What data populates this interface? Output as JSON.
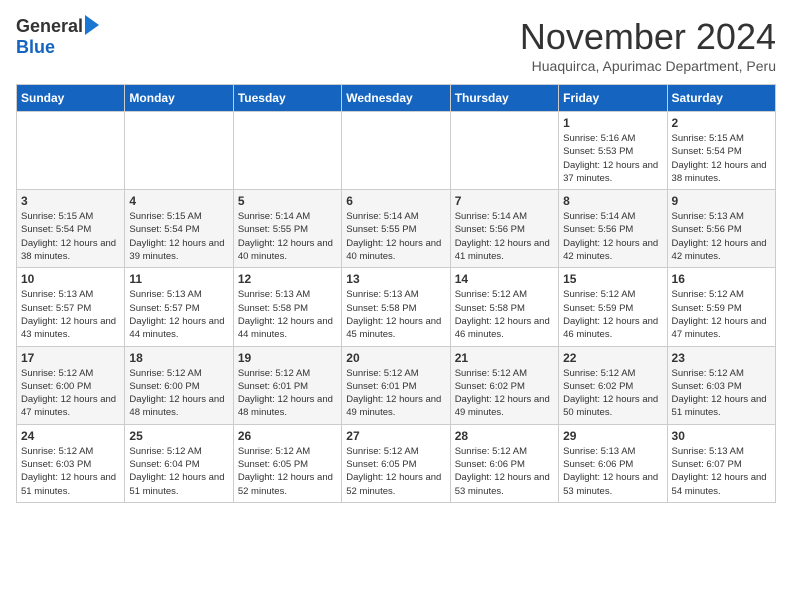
{
  "header": {
    "logo_general": "General",
    "logo_blue": "Blue",
    "month_title": "November 2024",
    "subtitle": "Huaquirca, Apurimac Department, Peru"
  },
  "weekdays": [
    "Sunday",
    "Monday",
    "Tuesday",
    "Wednesday",
    "Thursday",
    "Friday",
    "Saturday"
  ],
  "weeks": [
    [
      {
        "day": "",
        "info": ""
      },
      {
        "day": "",
        "info": ""
      },
      {
        "day": "",
        "info": ""
      },
      {
        "day": "",
        "info": ""
      },
      {
        "day": "",
        "info": ""
      },
      {
        "day": "1",
        "info": "Sunrise: 5:16 AM\nSunset: 5:53 PM\nDaylight: 12 hours\nand 37 minutes."
      },
      {
        "day": "2",
        "info": "Sunrise: 5:15 AM\nSunset: 5:54 PM\nDaylight: 12 hours\nand 38 minutes."
      }
    ],
    [
      {
        "day": "3",
        "info": "Sunrise: 5:15 AM\nSunset: 5:54 PM\nDaylight: 12 hours\nand 38 minutes."
      },
      {
        "day": "4",
        "info": "Sunrise: 5:15 AM\nSunset: 5:54 PM\nDaylight: 12 hours\nand 39 minutes."
      },
      {
        "day": "5",
        "info": "Sunrise: 5:14 AM\nSunset: 5:55 PM\nDaylight: 12 hours\nand 40 minutes."
      },
      {
        "day": "6",
        "info": "Sunrise: 5:14 AM\nSunset: 5:55 PM\nDaylight: 12 hours\nand 40 minutes."
      },
      {
        "day": "7",
        "info": "Sunrise: 5:14 AM\nSunset: 5:56 PM\nDaylight: 12 hours\nand 41 minutes."
      },
      {
        "day": "8",
        "info": "Sunrise: 5:14 AM\nSunset: 5:56 PM\nDaylight: 12 hours\nand 42 minutes."
      },
      {
        "day": "9",
        "info": "Sunrise: 5:13 AM\nSunset: 5:56 PM\nDaylight: 12 hours\nand 42 minutes."
      }
    ],
    [
      {
        "day": "10",
        "info": "Sunrise: 5:13 AM\nSunset: 5:57 PM\nDaylight: 12 hours\nand 43 minutes."
      },
      {
        "day": "11",
        "info": "Sunrise: 5:13 AM\nSunset: 5:57 PM\nDaylight: 12 hours\nand 44 minutes."
      },
      {
        "day": "12",
        "info": "Sunrise: 5:13 AM\nSunset: 5:58 PM\nDaylight: 12 hours\nand 44 minutes."
      },
      {
        "day": "13",
        "info": "Sunrise: 5:13 AM\nSunset: 5:58 PM\nDaylight: 12 hours\nand 45 minutes."
      },
      {
        "day": "14",
        "info": "Sunrise: 5:12 AM\nSunset: 5:58 PM\nDaylight: 12 hours\nand 46 minutes."
      },
      {
        "day": "15",
        "info": "Sunrise: 5:12 AM\nSunset: 5:59 PM\nDaylight: 12 hours\nand 46 minutes."
      },
      {
        "day": "16",
        "info": "Sunrise: 5:12 AM\nSunset: 5:59 PM\nDaylight: 12 hours\nand 47 minutes."
      }
    ],
    [
      {
        "day": "17",
        "info": "Sunrise: 5:12 AM\nSunset: 6:00 PM\nDaylight: 12 hours\nand 47 minutes."
      },
      {
        "day": "18",
        "info": "Sunrise: 5:12 AM\nSunset: 6:00 PM\nDaylight: 12 hours\nand 48 minutes."
      },
      {
        "day": "19",
        "info": "Sunrise: 5:12 AM\nSunset: 6:01 PM\nDaylight: 12 hours\nand 48 minutes."
      },
      {
        "day": "20",
        "info": "Sunrise: 5:12 AM\nSunset: 6:01 PM\nDaylight: 12 hours\nand 49 minutes."
      },
      {
        "day": "21",
        "info": "Sunrise: 5:12 AM\nSunset: 6:02 PM\nDaylight: 12 hours\nand 49 minutes."
      },
      {
        "day": "22",
        "info": "Sunrise: 5:12 AM\nSunset: 6:02 PM\nDaylight: 12 hours\nand 50 minutes."
      },
      {
        "day": "23",
        "info": "Sunrise: 5:12 AM\nSunset: 6:03 PM\nDaylight: 12 hours\nand 51 minutes."
      }
    ],
    [
      {
        "day": "24",
        "info": "Sunrise: 5:12 AM\nSunset: 6:03 PM\nDaylight: 12 hours\nand 51 minutes."
      },
      {
        "day": "25",
        "info": "Sunrise: 5:12 AM\nSunset: 6:04 PM\nDaylight: 12 hours\nand 51 minutes."
      },
      {
        "day": "26",
        "info": "Sunrise: 5:12 AM\nSunset: 6:05 PM\nDaylight: 12 hours\nand 52 minutes."
      },
      {
        "day": "27",
        "info": "Sunrise: 5:12 AM\nSunset: 6:05 PM\nDaylight: 12 hours\nand 52 minutes."
      },
      {
        "day": "28",
        "info": "Sunrise: 5:12 AM\nSunset: 6:06 PM\nDaylight: 12 hours\nand 53 minutes."
      },
      {
        "day": "29",
        "info": "Sunrise: 5:13 AM\nSunset: 6:06 PM\nDaylight: 12 hours\nand 53 minutes."
      },
      {
        "day": "30",
        "info": "Sunrise: 5:13 AM\nSunset: 6:07 PM\nDaylight: 12 hours\nand 54 minutes."
      }
    ]
  ]
}
